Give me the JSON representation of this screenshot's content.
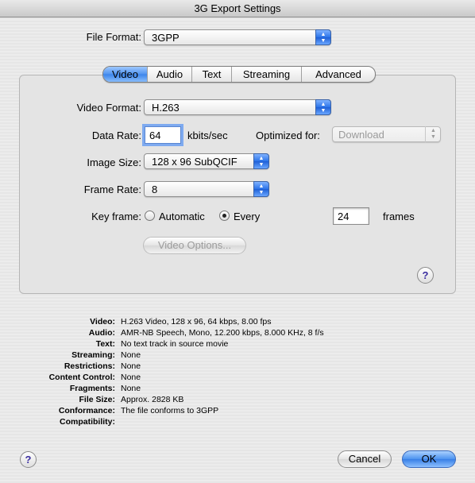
{
  "window": {
    "title": "3G Export Settings"
  },
  "file_format": {
    "label": "File Format:",
    "value": "3GPP"
  },
  "tabs": [
    {
      "label": "Video",
      "active": true
    },
    {
      "label": "Audio",
      "active": false
    },
    {
      "label": "Text",
      "active": false
    },
    {
      "label": "Streaming",
      "active": false
    },
    {
      "label": "Advanced",
      "active": false
    }
  ],
  "video": {
    "format_label": "Video Format:",
    "format_value": "H.263",
    "data_rate_label": "Data Rate:",
    "data_rate_value": "64",
    "data_rate_unit": "kbits/sec",
    "optimized_label": "Optimized for:",
    "optimized_value": "Download",
    "image_size_label": "Image Size:",
    "image_size_value": "128 x 96 SubQCIF",
    "frame_rate_label": "Frame Rate:",
    "frame_rate_value": "8",
    "key_frame_label": "Key frame:",
    "key_automatic_label": "Automatic",
    "key_every_label": "Every",
    "key_frames_value": "24",
    "key_frames_unit": "frames",
    "options_button": "Video Options...",
    "selected_key_frame": "Every"
  },
  "summary": [
    {
      "key": "Video:",
      "value": "H.263 Video, 128 x 96, 64 kbps, 8.00 fps"
    },
    {
      "key": "Audio:",
      "value": "AMR-NB Speech, Mono, 12.200 kbps, 8.000 KHz, 8 f/s"
    },
    {
      "key": "Text:",
      "value": "No text track in source movie"
    },
    {
      "key": "Streaming:",
      "value": "None"
    },
    {
      "key": "Restrictions:",
      "value": "None"
    },
    {
      "key": "Content Control:",
      "value": "None"
    },
    {
      "key": "Fragments:",
      "value": "None"
    },
    {
      "key": "File Size:",
      "value": "Approx. 2828 KB"
    },
    {
      "key": "Conformance:",
      "value": "The file conforms to 3GPP"
    },
    {
      "key": "Compatibility:",
      "value": ""
    }
  ],
  "buttons": {
    "cancel": "Cancel",
    "ok": "OK",
    "help": "?"
  },
  "colors": {
    "accent": "#3b84ea",
    "help_glyph": "#3b2ea0"
  }
}
